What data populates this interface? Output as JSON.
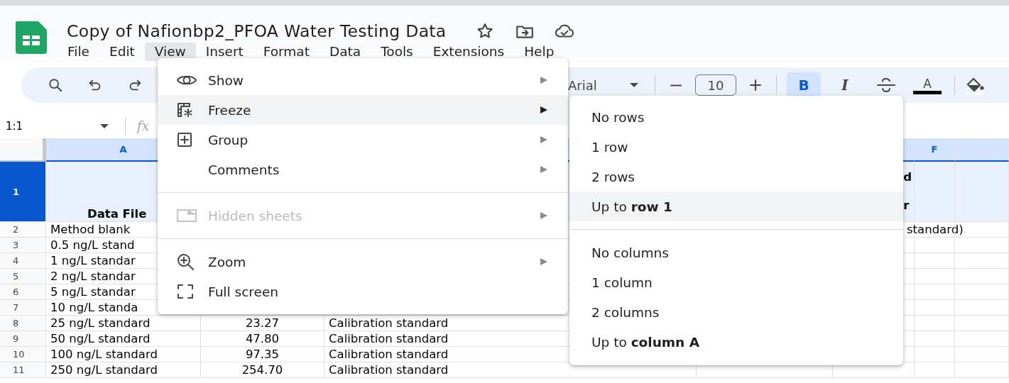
{
  "document": {
    "title": "Copy of Nafionbp2_PFOA Water Testing Data"
  },
  "menubar": [
    {
      "label": "File",
      "selected": false
    },
    {
      "label": "Edit",
      "selected": false
    },
    {
      "label": "View",
      "selected": true
    },
    {
      "label": "Insert",
      "selected": false
    },
    {
      "label": "Format",
      "selected": false
    },
    {
      "label": "Data",
      "selected": false
    },
    {
      "label": "Tools",
      "selected": false
    },
    {
      "label": "Extensions",
      "selected": false
    },
    {
      "label": "Help",
      "selected": false
    }
  ],
  "toolbar": {
    "font": "Arial",
    "font_size": "10",
    "format_buttons": [
      {
        "kind": "bold",
        "label": "B",
        "selected": true
      },
      {
        "kind": "italic",
        "label": "I",
        "selected": false
      },
      {
        "kind": "strikethrough",
        "selected": false
      },
      {
        "kind": "text-color",
        "label": "A",
        "selected": false
      }
    ]
  },
  "name_box": "1:1",
  "formula_label": "fx",
  "sheet": {
    "column_headers": {
      "A": "A",
      "F": "F"
    },
    "rows": [
      {
        "number": "1",
        "selected": true,
        "cells": {
          "A": "Data File",
          "E": "d\nr"
        }
      },
      {
        "number": "2",
        "selected": false,
        "cells": {
          "A": "Method blank",
          "E": "standard)"
        }
      },
      {
        "number": "3",
        "selected": false,
        "cells": {
          "A": "0.5 ng/L stand"
        }
      },
      {
        "number": "4",
        "selected": false,
        "cells": {
          "A": "1 ng/L standar"
        }
      },
      {
        "number": "5",
        "selected": false,
        "cells": {
          "A": "2 ng/L standar"
        }
      },
      {
        "number": "6",
        "selected": false,
        "cells": {
          "A": "5 ng/L standar"
        }
      },
      {
        "number": "7",
        "selected": false,
        "cells": {
          "A": "10 ng/L standa"
        }
      },
      {
        "number": "8",
        "selected": false,
        "cells": {
          "A": "25 ng/L standard",
          "B": "23.27",
          "C": "Calibration standard"
        }
      },
      {
        "number": "9",
        "selected": false,
        "cells": {
          "A": "50 ng/L standard",
          "B": "47.80",
          "C": "Calibration standard"
        }
      },
      {
        "number": "10",
        "selected": false,
        "cells": {
          "A": "100 ng/L standard",
          "B": "97.35",
          "C": "Calibration standard"
        }
      },
      {
        "number": "11",
        "selected": false,
        "cells": {
          "A": "250 ng/L standard",
          "B": "254.70",
          "C": "Calibration standard"
        }
      }
    ]
  },
  "view_menu": {
    "items": [
      {
        "kind": "item",
        "label": "Show",
        "submenu": true,
        "selected": false,
        "disabled": false
      },
      {
        "kind": "item",
        "label": "Freeze",
        "submenu": true,
        "selected": true,
        "disabled": false
      },
      {
        "kind": "item",
        "label": "Group",
        "submenu": true,
        "selected": false,
        "disabled": false
      },
      {
        "kind": "item",
        "label": "Comments",
        "submenu": true,
        "selected": false,
        "disabled": false
      },
      {
        "kind": "divider"
      },
      {
        "kind": "item",
        "label": "Hidden sheets",
        "submenu": true,
        "selected": false,
        "disabled": true
      },
      {
        "kind": "divider"
      },
      {
        "kind": "item",
        "label": "Zoom",
        "submenu": true,
        "selected": false,
        "disabled": false
      },
      {
        "kind": "item",
        "label": "Full screen",
        "submenu": false,
        "selected": false,
        "disabled": false
      }
    ]
  },
  "freeze_submenu": {
    "items": [
      {
        "kind": "item",
        "label": "No rows",
        "selected": false
      },
      {
        "kind": "item",
        "label": "1 row",
        "selected": false
      },
      {
        "kind": "item",
        "label": "2 rows",
        "selected": false
      },
      {
        "kind": "item",
        "label": "Up to **row 1**",
        "selected": true
      },
      {
        "kind": "divider"
      },
      {
        "kind": "item",
        "label": "No columns",
        "selected": false
      },
      {
        "kind": "item",
        "label": "1 column",
        "selected": false
      },
      {
        "kind": "item",
        "label": "2 columns",
        "selected": false
      },
      {
        "kind": "item",
        "label": "Up to **column A**",
        "selected": false
      }
    ]
  }
}
